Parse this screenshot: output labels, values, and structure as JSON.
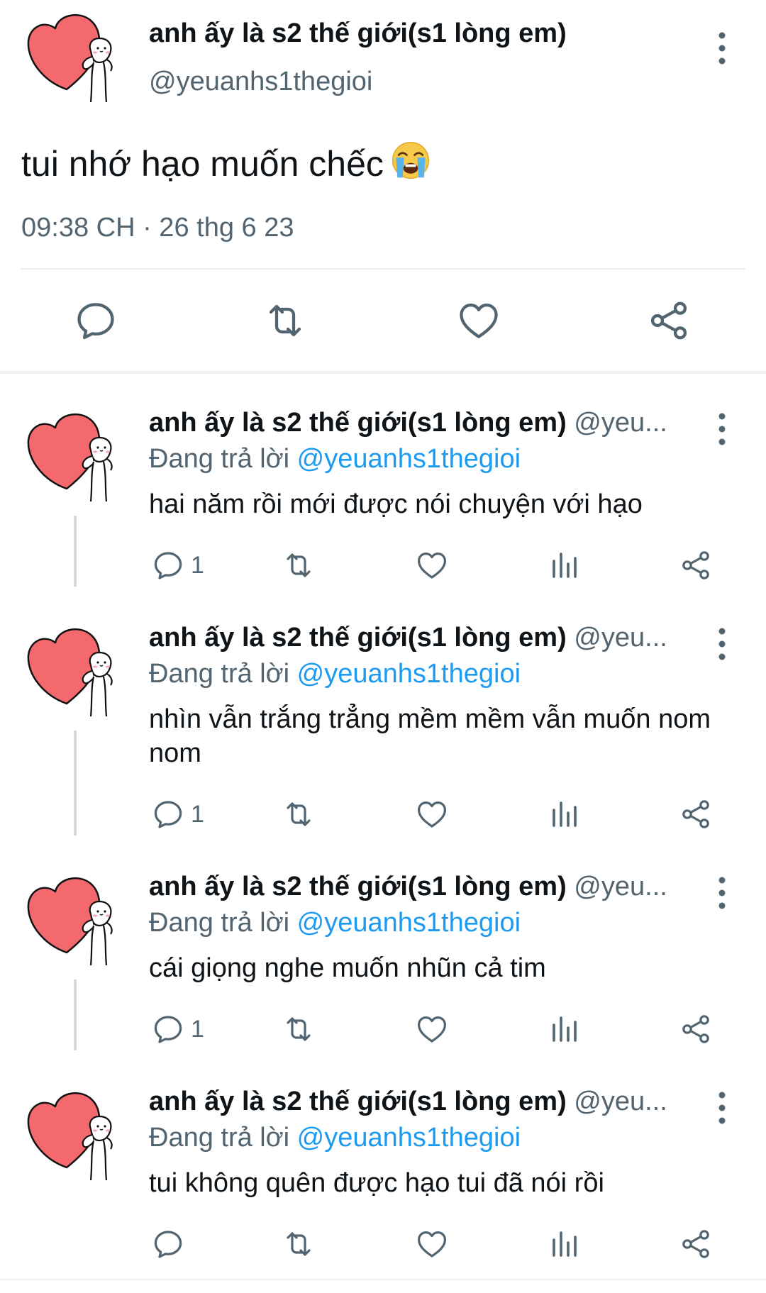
{
  "tweet": {
    "author_name": "anh ấy là s2 thế giới(s1 lòng em)",
    "author_handle": "@yeuanhs1thegioi",
    "text": "tui nhớ hạo muốn chếc",
    "emoji": "loudly-crying-face",
    "timestamp": "09:38 CH · 26 thg 6 23",
    "actions": [
      "reply-icon",
      "retweet-icon",
      "like-icon",
      "share-icon"
    ]
  },
  "replies": [
    {
      "author_name": "anh ấy là s2 thế giới(s1 lòng em)",
      "author_handle": "@yeu...",
      "replying_prefix": "Đang trả lời",
      "replying_to": "@yeuanhs1thegioi",
      "text": "hai năm rồi mới được nói chuyện với hạo",
      "reply_count": "1"
    },
    {
      "author_name": "anh ấy là s2 thế giới(s1 lòng em)",
      "author_handle": "@yeu...",
      "replying_prefix": "Đang trả lời",
      "replying_to": "@yeuanhs1thegioi",
      "text": "nhìn vẫn trắng trẳng mềm mềm vẫn muốn nom nom",
      "reply_count": "1"
    },
    {
      "author_name": "anh ấy là s2 thế giới(s1 lòng em)",
      "author_handle": "@yeu...",
      "replying_prefix": "Đang trả lời",
      "replying_to": "@yeuanhs1thegioi",
      "text": "cái giọng nghe muốn nhũn cả tim",
      "reply_count": "1"
    },
    {
      "author_name": "anh ấy là s2 thế giới(s1 lòng em)",
      "author_handle": "@yeu...",
      "replying_prefix": "Đang trả lời",
      "replying_to": "@yeuanhs1thegioi",
      "text": "tui không quên được hạo tui đã nói rồi",
      "reply_count": ""
    }
  ],
  "colors": {
    "text": "#0f1419",
    "secondary": "#536471",
    "link": "#1d9bf0",
    "heart_fill": "#f4696d",
    "divider": "#eef1f3",
    "thread_line": "#cfd9de"
  }
}
